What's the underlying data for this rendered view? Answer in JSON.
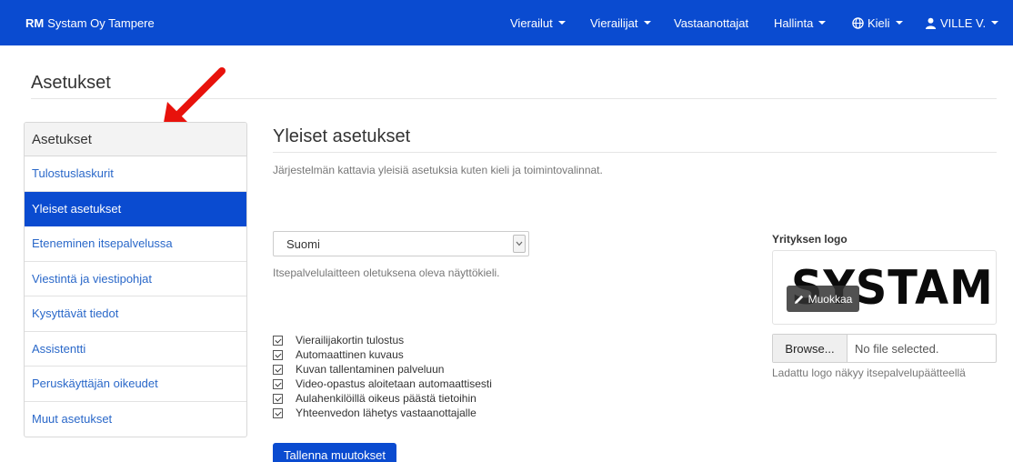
{
  "navbar": {
    "brand_bold": "RM",
    "brand_rest": "Systam Oy Tampere",
    "items": [
      {
        "label": "Vierailut",
        "dropdown": true
      },
      {
        "label": "Vierailijat",
        "dropdown": true
      },
      {
        "label": "Vastaanottajat",
        "dropdown": false
      },
      {
        "label": "Hallinta",
        "dropdown": true
      },
      {
        "label": "Kieli",
        "dropdown": true,
        "icon": "globe-icon"
      },
      {
        "label": "VILLE V.",
        "dropdown": true,
        "icon": "user-icon"
      }
    ]
  },
  "page": {
    "title": "Asetukset"
  },
  "sidebar": {
    "header": "Asetukset",
    "items": [
      {
        "label": "Tulostuslaskurit",
        "active": false
      },
      {
        "label": "Yleiset asetukset",
        "active": true
      },
      {
        "label": "Eteneminen itsepalvelussa",
        "active": false
      },
      {
        "label": "Viestintä ja viestipohjat",
        "active": false
      },
      {
        "label": "Kysyttävät tiedot",
        "active": false
      },
      {
        "label": "Assistentti",
        "active": false
      },
      {
        "label": "Peruskäyttäjän oikeudet",
        "active": false
      },
      {
        "label": "Muut asetukset",
        "active": false
      }
    ]
  },
  "main": {
    "title": "Yleiset asetukset",
    "description": "Järjestelmän kattavia yleisiä asetuksia kuten kieli ja toimintovalinnat.",
    "language_select": {
      "value": "Suomi",
      "help": "Itsepalvelulaitteen oletuksena oleva näyttökieli."
    },
    "checkboxes": [
      {
        "label": "Vierailijakortin tulostus",
        "checked": true
      },
      {
        "label": "Automaattinen kuvaus",
        "checked": true
      },
      {
        "label": "Kuvan tallentaminen palveluun",
        "checked": true
      },
      {
        "label": "Video-opastus aloitetaan automaattisesti",
        "checked": true
      },
      {
        "label": "Aulahenkilöillä oikeus päästä tietoihin",
        "checked": true
      },
      {
        "label": "Yhteenvedon lähetys vastaanottajalle",
        "checked": true
      }
    ],
    "save_label": "Tallenna muutokset"
  },
  "logo": {
    "label": "Yrityksen logo",
    "logo_text": "SYSTAM",
    "edit_label": "Muokkaa",
    "browse_label": "Browse...",
    "file_status": "No file selected.",
    "help": "Ladattu logo näkyy itsepalvelupäätteellä"
  },
  "colors": {
    "navbar": "#0a4bd0",
    "link": "#2a68c9",
    "arrow": "#e8120c"
  }
}
